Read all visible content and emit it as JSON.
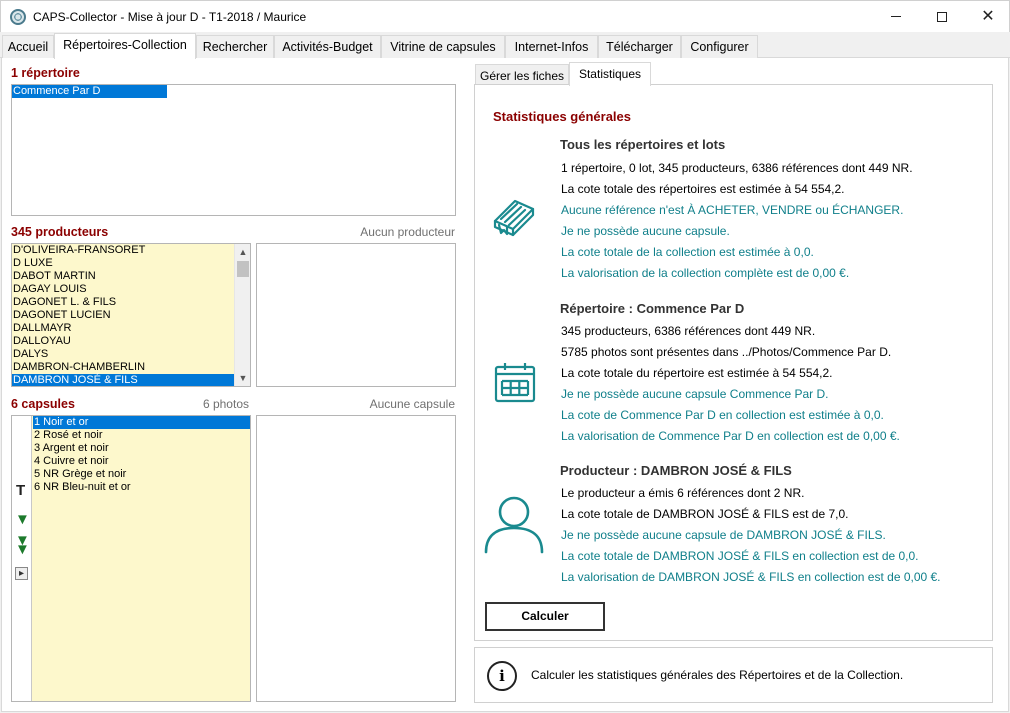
{
  "window": {
    "title": "CAPS-Collector - Mise à jour D - T1-2018 / Maurice",
    "close_glyph": "✕"
  },
  "main_tabs": [
    {
      "label": "Accueil"
    },
    {
      "label": "Répertoires-Collection"
    },
    {
      "label": "Rechercher"
    },
    {
      "label": "Activités-Budget"
    },
    {
      "label": "Vitrine de capsules"
    },
    {
      "label": "Internet-Infos"
    },
    {
      "label": "Télécharger"
    },
    {
      "label": "Configurer"
    }
  ],
  "repertoires": {
    "title": "1 répertoire",
    "items": [
      "Commence Par D"
    ]
  },
  "producers": {
    "title": "345 producteurs",
    "note": "Aucun producteur",
    "items": [
      "D'OLIVEIRA-FRANSORET",
      "D LUXE",
      "DABOT MARTIN",
      "DAGAY LOUIS",
      "DAGONET L. & FILS",
      "DAGONET LUCIEN",
      "DALLMAYR",
      "DALLOYAU",
      "DALYS",
      "DAMBRON-CHAMBERLIN",
      "DAMBRON JOSÉ & FILS"
    ],
    "selected_index": 10,
    "scroll_up": "▲",
    "scroll_down": "▼"
  },
  "capsules": {
    "title": "6 capsules",
    "photos": "6 photos",
    "note": "Aucune capsule",
    "items": [
      "1 Noir et or",
      "2 Rosé et noir",
      "3 Argent et noir",
      "4 Cuivre et noir",
      "5 NR Grège et noir",
      "6 NR Bleu-nuit et or"
    ],
    "selected_index": 0,
    "tools": {
      "text_tool": "T",
      "next_glyph": "▼",
      "last_glyph": "▼",
      "play_glyph": "▸"
    }
  },
  "sub_tabs": [
    {
      "label": "Gérer les fiches"
    },
    {
      "label": "Statistiques"
    }
  ],
  "stats": {
    "heading": "Statistiques générales",
    "all": {
      "title": "Tous les répertoires et lots",
      "lines": [
        "1 répertoire, 0 lot, 345 producteurs, 6386 références dont 449 NR.",
        "La cote totale des répertoires est estimée à 54 554,2."
      ],
      "links": [
        "Aucune référence n'est À ACHETER, VENDRE ou ÉCHANGER.",
        "Je ne possède aucune capsule.",
        "La cote totale de la collection est estimée à 0,0.",
        "La valorisation de la collection complète est de 0,00 €."
      ]
    },
    "repertoire": {
      "title": "Répertoire : Commence Par D",
      "lines": [
        "345 producteurs, 6386 références dont 449 NR.",
        "5785 photos sont présentes dans ../Photos/Commence Par D.",
        "La cote totale du répertoire est estimée à 54 554,2."
      ],
      "links": [
        "Je ne possède aucune capsule Commence Par D.",
        "La cote de Commence Par D en collection est estimée à 0,0.",
        "La valorisation de Commence Par D en collection est de 0,00 €."
      ]
    },
    "producer": {
      "title": "Producteur : DAMBRON JOSÉ & FILS",
      "lines": [
        "Le producteur a émis 6 références dont 2 NR.",
        "La cote totale de DAMBRON JOSÉ & FILS est de 7,0."
      ],
      "links": [
        "Je ne possède aucune capsule de DAMBRON JOSÉ & FILS.",
        "La cote totale de DAMBRON JOSÉ & FILS en collection est de 0,0.",
        "La valorisation de DAMBRON JOSÉ & FILS en collection est de 0,00 €."
      ]
    },
    "calc_button": "Calculer"
  },
  "info": {
    "glyph": "i",
    "text": "Calculer les statistiques générales des Répertoires et de la Collection."
  },
  "colors": {
    "accent": "#0078d7",
    "section_title": "#8b0000",
    "link": "#0f7f8a",
    "icon": "#1a8a8f",
    "list_yellow": "#fdf8cc"
  }
}
